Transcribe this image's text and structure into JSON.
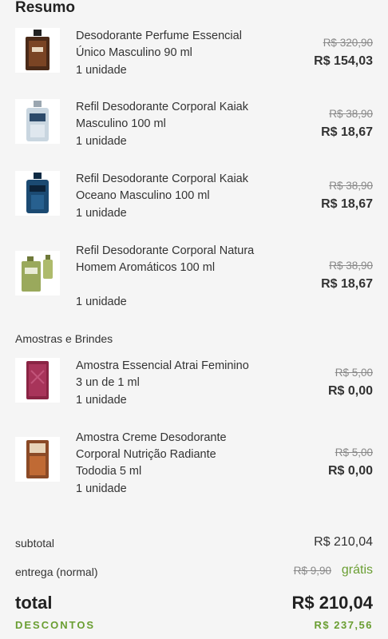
{
  "summary": {
    "title": "Resumo"
  },
  "items": [
    {
      "name": "Desodorante Perfume Essencial Único Masculino 90 ml",
      "qty": "1 unidade",
      "old_price": "R$ 320,90",
      "price": "R$ 154,03",
      "icon": "perfume-bottle-icon"
    },
    {
      "name": "Refil Desodorante Corporal Kaiak Masculino 100 ml",
      "qty": "1 unidade",
      "old_price": "R$ 38,90",
      "price": "R$ 18,67",
      "icon": "perfume-bottle-icon"
    },
    {
      "name": "Refil Desodorante Corporal Kaiak Oceano Masculino 100 ml",
      "qty": "1 unidade",
      "old_price": "R$ 38,90",
      "price": "R$ 18,67",
      "icon": "perfume-bottle-icon"
    },
    {
      "name": "Refil Desodorante Corporal Natura Homem Aromáticos 100 ml",
      "qty": "1 unidade",
      "old_price": "R$ 38,90",
      "price": "R$ 18,67",
      "icon": "perfume-bottle-icon"
    }
  ],
  "samples": {
    "label": "Amostras e Brindes",
    "items": [
      {
        "name": "Amostra Essencial Atrai Feminino 3 un de 1 ml",
        "qty": "1 unidade",
        "old_price": "R$ 5,00",
        "price": "R$ 0,00",
        "icon": "sample-sachet-icon"
      },
      {
        "name": "Amostra Creme Desodorante Corporal Nutrição Radiante Tododia 5 ml",
        "qty": "1 unidade",
        "old_price": "R$ 5,00",
        "price": "R$ 0,00",
        "icon": "sample-sachet-icon"
      }
    ]
  },
  "totals": {
    "subtotal_label": "subtotal",
    "subtotal_value": "R$ 210,04",
    "delivery_label": "entrega (normal)",
    "delivery_old": "R$ 9,90",
    "delivery_value": "grátis",
    "total_label": "total",
    "total_value": "R$ 210,04",
    "discounts_label": "DESCONTOS",
    "discounts_value": "R$ 237,56"
  },
  "colors": {
    "accent_green": "#6a9e32"
  }
}
